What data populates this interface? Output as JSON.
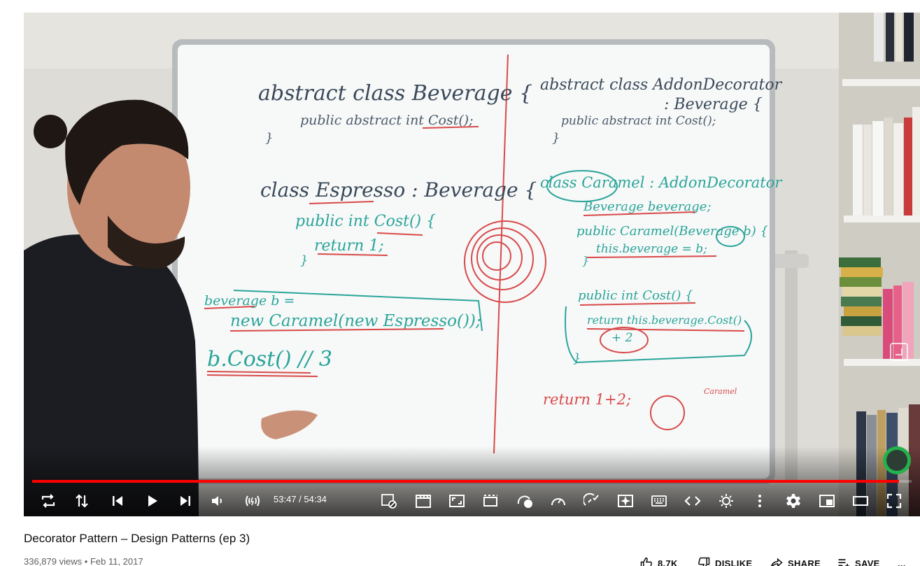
{
  "video": {
    "title": "Decorator Pattern – Design Patterns (ep 3)",
    "views": "336,879 views",
    "separator": "•",
    "date": "Feb 11, 2017"
  },
  "whiteboard": {
    "left": {
      "line1": "abstract class Beverage {",
      "line2": "public abstract int Cost();",
      "line3": "}",
      "line4": "class Espresso : Beverage {",
      "line5": "public int Cost() {",
      "line6": "return 1;",
      "line7": "}",
      "line8": "beverage b =",
      "line9": "new Caramel(new Espresso());",
      "line10": "b.Cost() // 3"
    },
    "right": {
      "line1": "abstract class AddonDecorator",
      "line2": ": Beverage {",
      "line3": "public abstract int Cost();",
      "line4": "}",
      "line5": "class Caramel : AddonDecorator",
      "line6": "Beverage beverage;",
      "line7": "public Caramel(Beverage b) {",
      "line8": "this.beverage = b;",
      "line9": "}",
      "line10": "public int Cost() {",
      "line11": "return this.beverage.Cost()",
      "line12": "+ 2",
      "line13": "}",
      "line14": "return 1+2;",
      "line15": "Caramel"
    }
  },
  "player": {
    "current_time": "53:47",
    "duration": "54:34",
    "time_text": "53:47 / 54:34",
    "progress": 0.9857,
    "progress_color": "#ff0000",
    "icon_color": "#ffffff"
  },
  "controls": [
    {
      "name": "loop-icon"
    },
    {
      "name": "sort-icon"
    },
    {
      "name": "previous-icon"
    },
    {
      "name": "play-icon"
    },
    {
      "name": "next-icon"
    },
    {
      "name": "volume-icon"
    },
    {
      "name": "live-audio-icon"
    },
    {
      "name": "ad-block-icon"
    },
    {
      "name": "theater-clapper-icon"
    },
    {
      "name": "crop-icon"
    },
    {
      "name": "frame-icon"
    },
    {
      "name": "speed-badge-icon"
    },
    {
      "name": "speedometer-icon"
    },
    {
      "name": "speed-check-icon"
    },
    {
      "name": "sparkle-icon"
    },
    {
      "name": "keyboard-icon"
    },
    {
      "name": "code-icon"
    },
    {
      "name": "brightness-icon"
    },
    {
      "name": "more-vert-icon"
    },
    {
      "name": "settings-icon"
    },
    {
      "name": "miniplayer-icon"
    },
    {
      "name": "theater-mode-icon"
    },
    {
      "name": "fullscreen-icon"
    }
  ],
  "actions": {
    "likes": "8.7K",
    "dislike": "DISLIKE",
    "share": "SHARE",
    "save": "SAVE",
    "more": "..."
  }
}
